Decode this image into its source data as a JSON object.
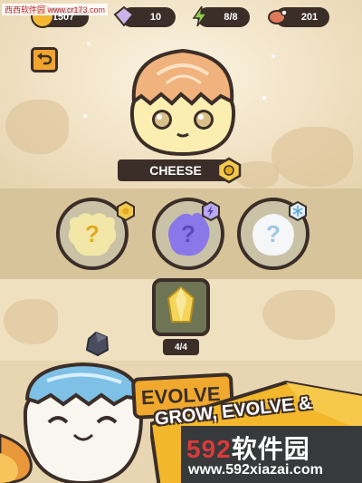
{
  "watermark_top": "西西软件园 www.cr173.com",
  "resources": {
    "coins": "1507",
    "gems": "10",
    "energy": "8/8",
    "meat": "201"
  },
  "pet": {
    "name": "CHEESE"
  },
  "evolutions": [
    {
      "label": "?",
      "element": "coin-icon",
      "color": "#f3e7a8"
    },
    {
      "label": "?",
      "element": "lightning-icon",
      "color": "#8b78e8"
    },
    {
      "label": "?",
      "element": "snowflake-icon",
      "color": "#eef3f7"
    }
  ],
  "item": {
    "count": "4/4"
  },
  "evolve_button": "EVOLVE",
  "promo": {
    "text": "GROW, EVOLVE &"
  },
  "site_watermark": {
    "brand_num": "592",
    "brand_text": "软件园",
    "url": "www.592xiazai.com"
  },
  "colors": {
    "outline": "#3b2e28",
    "accent": "#f0a92e",
    "band": "#d8c49b"
  }
}
